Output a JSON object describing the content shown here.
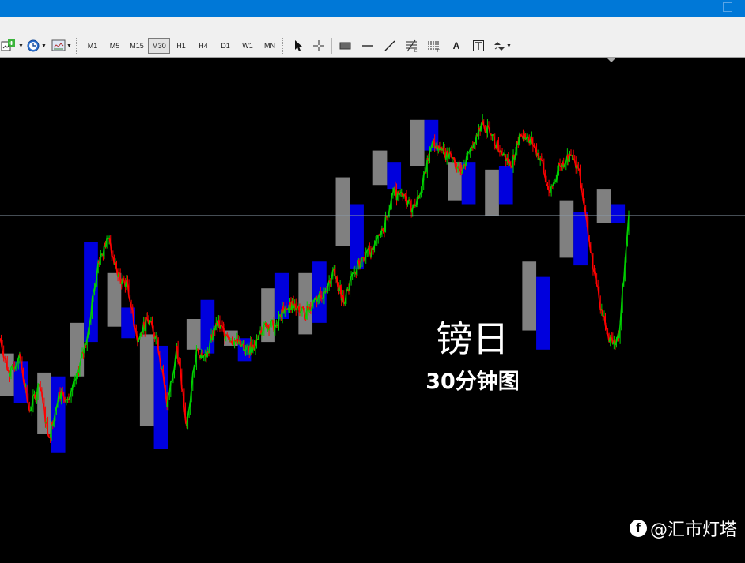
{
  "window": {
    "accent": "#0078d7"
  },
  "toolbar": {
    "timeframes": [
      "M1",
      "M5",
      "M15",
      "M30",
      "H1",
      "H4",
      "D1",
      "W1",
      "MN"
    ],
    "active_timeframe": "M30",
    "left_icons": [
      "new-chart-icon",
      "clock-icon",
      "chart-template-icon"
    ],
    "tool_icons": [
      "cursor-icon",
      "crosshair-icon",
      "rectangle-icon",
      "horizontal-line-icon",
      "trend-line-icon",
      "fibonacci-icon",
      "channel-icon",
      "text-icon",
      "text-label-icon",
      "arrows-icon"
    ],
    "text_tool_label": "A"
  },
  "chart": {
    "title": "镑日",
    "subtitle": "30分钟图",
    "colors": {
      "up": "#00d000",
      "down": "#ff0000",
      "box_up": "#808080",
      "box_down": "#0000dd",
      "price_line": "#8a9aa8",
      "background": "#000000"
    }
  },
  "watermark": {
    "text": "@汇市灯塔",
    "icon": "facebook-icon"
  },
  "chart_data": {
    "type": "line",
    "title": "镑日",
    "subtitle": "30分钟图",
    "xlabel": "",
    "ylabel": "",
    "ylim": [
      0,
      100
    ],
    "note_values": "relative price level (no axis printed)",
    "x": [
      0,
      1,
      2,
      3,
      4,
      5,
      6,
      7,
      8,
      9,
      10,
      11,
      12,
      13,
      14,
      15,
      16,
      17,
      18,
      19,
      20,
      21,
      22,
      23,
      24,
      25,
      26,
      27,
      28,
      29,
      30,
      31,
      32,
      33,
      34,
      35,
      36,
      37,
      38,
      39,
      40,
      41,
      42,
      43,
      44,
      45,
      46,
      47,
      48,
      49,
      50,
      51,
      52,
      53,
      54,
      55,
      56,
      57,
      58,
      59,
      60,
      61,
      62,
      63,
      64
    ],
    "values": [
      35,
      25,
      31,
      16,
      23,
      9,
      21,
      19,
      26,
      37,
      55,
      61,
      51,
      49,
      34,
      40,
      35,
      17,
      33,
      12,
      32,
      30,
      39,
      36,
      34,
      32,
      33,
      39,
      38,
      43,
      44,
      41,
      45,
      47,
      53,
      44,
      52,
      56,
      58,
      63,
      73,
      72,
      69,
      75,
      86,
      84,
      82,
      78,
      85,
      91,
      88,
      84,
      80,
      88,
      87,
      82,
      73,
      80,
      83,
      79,
      60,
      45,
      34,
      35,
      67
    ],
    "boxes": [
      {
        "x0": 0,
        "x1": 3,
        "high": 31,
        "low": 20,
        "dir": "up"
      },
      {
        "x0": 3,
        "x1": 6,
        "high": 29,
        "low": 18,
        "dir": "down"
      },
      {
        "x0": 8,
        "x1": 11,
        "high": 26,
        "low": 10,
        "dir": "up"
      },
      {
        "x0": 11,
        "x1": 14,
        "high": 25,
        "low": 5,
        "dir": "down"
      },
      {
        "x0": 15,
        "x1": 18,
        "high": 39,
        "low": 25,
        "dir": "up"
      },
      {
        "x0": 18,
        "x1": 21,
        "high": 60,
        "low": 34,
        "dir": "down"
      },
      {
        "x0": 23,
        "x1": 26,
        "high": 52,
        "low": 38,
        "dir": "up"
      },
      {
        "x0": 26,
        "x1": 29,
        "high": 43,
        "low": 35,
        "dir": "down"
      },
      {
        "x0": 30,
        "x1": 33,
        "high": 36,
        "low": 12,
        "dir": "up"
      },
      {
        "x0": 33,
        "x1": 36,
        "high": 33,
        "low": 6,
        "dir": "down"
      },
      {
        "x0": 40,
        "x1": 43,
        "high": 40,
        "low": 32,
        "dir": "up"
      },
      {
        "x0": 43,
        "x1": 46,
        "high": 45,
        "low": 31,
        "dir": "down"
      },
      {
        "x0": 48,
        "x1": 51,
        "high": 37,
        "low": 33,
        "dir": "up"
      },
      {
        "x0": 51,
        "x1": 54,
        "high": 35,
        "low": 29,
        "dir": "down"
      },
      {
        "x0": 56,
        "x1": 59,
        "high": 48,
        "low": 34,
        "dir": "up"
      },
      {
        "x0": 59,
        "x1": 62,
        "high": 52,
        "low": 40,
        "dir": "down"
      },
      {
        "x0": 64,
        "x1": 67,
        "high": 52,
        "low": 36,
        "dir": "up"
      },
      {
        "x0": 67,
        "x1": 70,
        "high": 55,
        "low": 39,
        "dir": "down"
      },
      {
        "x0": 72,
        "x1": 75,
        "high": 77,
        "low": 59,
        "dir": "up"
      },
      {
        "x0": 75,
        "x1": 78,
        "high": 70,
        "low": 53,
        "dir": "down"
      },
      {
        "x0": 80,
        "x1": 83,
        "high": 84,
        "low": 75,
        "dir": "up"
      },
      {
        "x0": 83,
        "x1": 86,
        "high": 81,
        "low": 74,
        "dir": "down"
      },
      {
        "x0": 88,
        "x1": 91,
        "high": 92,
        "low": 80,
        "dir": "up"
      },
      {
        "x0": 91,
        "x1": 94,
        "high": 92,
        "low": 84,
        "dir": "down"
      },
      {
        "x0": 96,
        "x1": 99,
        "high": 81,
        "low": 71,
        "dir": "up"
      },
      {
        "x0": 99,
        "x1": 102,
        "high": 81,
        "low": 70,
        "dir": "down"
      },
      {
        "x0": 104,
        "x1": 107,
        "high": 79,
        "low": 67,
        "dir": "up"
      },
      {
        "x0": 107,
        "x1": 110,
        "high": 80,
        "low": 70,
        "dir": "down"
      },
      {
        "x0": 112,
        "x1": 115,
        "high": 55,
        "low": 37,
        "dir": "up"
      },
      {
        "x0": 115,
        "x1": 118,
        "high": 51,
        "low": 32,
        "dir": "down"
      },
      {
        "x0": 120,
        "x1": 123,
        "high": 71,
        "low": 56,
        "dir": "up"
      },
      {
        "x0": 123,
        "x1": 126,
        "high": 68,
        "low": 54,
        "dir": "down"
      },
      {
        "x0": 128,
        "x1": 131,
        "high": 74,
        "low": 65,
        "dir": "up"
      },
      {
        "x0": 131,
        "x1": 134,
        "high": 70,
        "low": 65,
        "dir": "down"
      }
    ]
  }
}
